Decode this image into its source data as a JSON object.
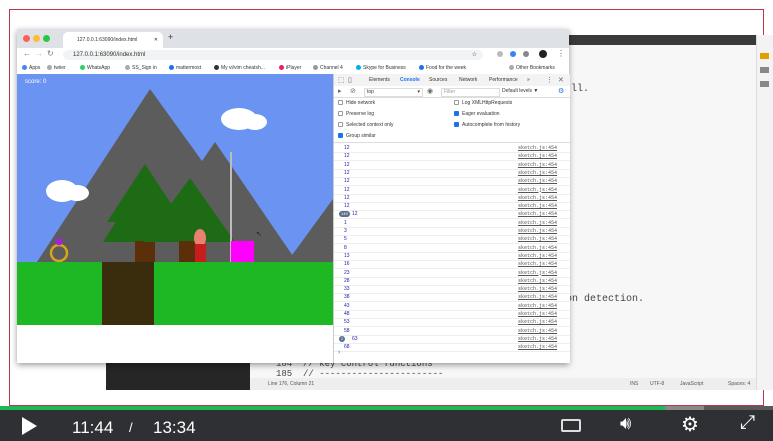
{
  "editor": {
    "lines": [
      {
        "num": "184",
        "code": "// key control functions"
      },
      {
        "num": "185",
        "code": "// -----------------------"
      }
    ],
    "fragments": [
      "ll.",
      "on detection."
    ],
    "status": {
      "position": "Line 176, Column 21",
      "ins": "INS",
      "encoding": "UTF-8",
      "language": "JavaScript",
      "spaces": "Spaces: 4"
    }
  },
  "browser": {
    "tab_title": "127.0.0.1:63090/index.html",
    "url": "127.0.0.1:63090/index.html",
    "bookmarks": [
      "Apps",
      "twiier",
      "WhatsApp",
      "SS_Sign in",
      "mattermost",
      "My vi/vim cheatsh...",
      "iPlayer",
      "Channel 4",
      "Skype for Business",
      "Food for the week",
      "Other Bookmarks"
    ]
  },
  "game": {
    "score_label": "score: 0"
  },
  "devtools": {
    "tabs": [
      "Elements",
      "Console",
      "Sources",
      "Network",
      "Performance"
    ],
    "more": "»",
    "context": "top",
    "filter_placeholder": "Filter",
    "levels": "Default levels ▼",
    "options_left": [
      {
        "label": "Hide network",
        "checked": false
      },
      {
        "label": "Preserve log",
        "checked": false
      },
      {
        "label": "Selected context only",
        "checked": false
      },
      {
        "label": "Group similar",
        "checked": true
      }
    ],
    "options_right": [
      {
        "label": "Log XMLHttpRequests",
        "checked": false
      },
      {
        "label": "Eager evaluation",
        "checked": true
      },
      {
        "label": "Autocomplete from history",
        "checked": true
      }
    ],
    "source": "sketch.js:454",
    "logs": [
      {
        "badge": "",
        "value": "12"
      },
      {
        "badge": "",
        "value": "12"
      },
      {
        "badge": "",
        "value": "12"
      },
      {
        "badge": "",
        "value": "12"
      },
      {
        "badge": "",
        "value": "12"
      },
      {
        "badge": "",
        "value": "12"
      },
      {
        "badge": "",
        "value": "12"
      },
      {
        "badge": "",
        "value": "12"
      },
      {
        "badge": "149",
        "value": "12"
      },
      {
        "badge": "",
        "value": "1"
      },
      {
        "badge": "",
        "value": "3"
      },
      {
        "badge": "",
        "value": "5"
      },
      {
        "badge": "",
        "value": "8"
      },
      {
        "badge": "",
        "value": "13"
      },
      {
        "badge": "",
        "value": "16"
      },
      {
        "badge": "",
        "value": "23"
      },
      {
        "badge": "",
        "value": "28"
      },
      {
        "badge": "",
        "value": "33"
      },
      {
        "badge": "",
        "value": "38"
      },
      {
        "badge": "",
        "value": "43"
      },
      {
        "badge": "",
        "value": "48"
      },
      {
        "badge": "",
        "value": "53"
      },
      {
        "badge": "",
        "value": "58"
      },
      {
        "badge": "2",
        "value": "63"
      },
      {
        "badge": "",
        "value": "68"
      }
    ],
    "prompt": "›"
  },
  "player": {
    "current_time": "11:44",
    "separator": "/",
    "duration": "13:34",
    "progress": 0.86
  }
}
